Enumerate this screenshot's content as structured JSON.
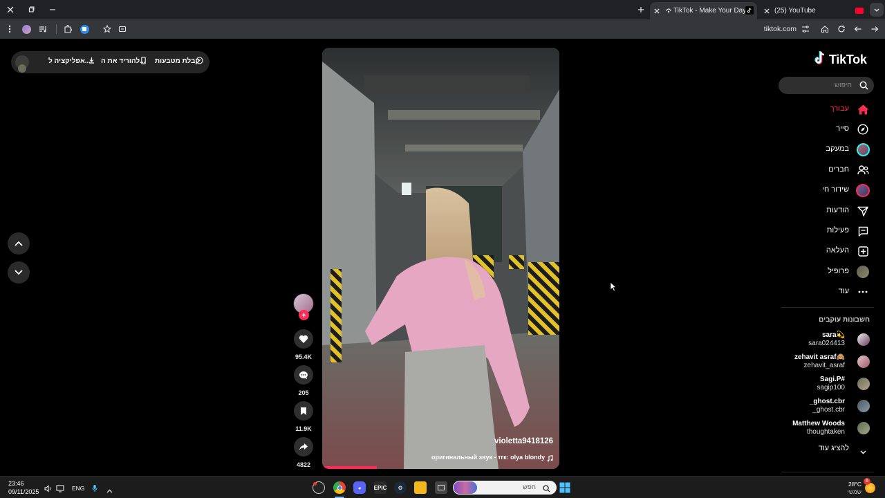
{
  "browser": {
    "tabs": [
      {
        "title": "TikTok - Make Your Day",
        "active": true
      },
      {
        "title": "(25) YouTube",
        "active": false
      }
    ],
    "address": "tiktok.com"
  },
  "banner": {
    "coins": "קבלת מטבעות",
    "download": "להוריד את ה...",
    "app": "אפליקציה ל..."
  },
  "tiktok": {
    "logo_text": "TikTok",
    "search_placeholder": "חיפוש",
    "nav": [
      {
        "label": "עבורך",
        "icon": "home-icon",
        "active": true
      },
      {
        "label": "סייר",
        "icon": "compass-icon"
      },
      {
        "label": "במעקב",
        "icon": "following-avatar-icon"
      },
      {
        "label": "חברים",
        "icon": "friends-icon"
      },
      {
        "label": "שידור חי",
        "icon": "live-icon"
      },
      {
        "label": "הודעות",
        "icon": "send-icon"
      },
      {
        "label": "פעילות",
        "icon": "activity-icon"
      },
      {
        "label": "העלאה",
        "icon": "upload-icon"
      },
      {
        "label": "פרופיל",
        "icon": "profile-avatar-icon"
      },
      {
        "label": "עוד",
        "icon": "more-icon"
      }
    ],
    "following_title": "חשבונות עוקבים",
    "following": [
      {
        "name": "sara💫",
        "handle": "sara024413"
      },
      {
        "name": "zehavit asraf🙈",
        "handle": "zehavit_asraf"
      },
      {
        "name": "Sagi.P#",
        "handle": "sagip100"
      },
      {
        "name": "_ghost.cbr",
        "handle": "_ghost.cbr"
      },
      {
        "name": "Matthew Woods",
        "handle": "thoughtaken"
      }
    ],
    "show_more": "להציג עוד",
    "accent": "#fe2c55"
  },
  "video": {
    "author": "violetta9418126",
    "sound": "оригинальный звук - тгк: olya blondy",
    "progress": 0.23,
    "likes": "95.4K",
    "comments": "205",
    "saves": "11.9K",
    "shares": "4822"
  },
  "taskbar": {
    "time": "23:46",
    "date": "09/11/2025",
    "lang": "ENG",
    "search_placeholder": "חפש",
    "weather_temp": "28°C",
    "weather_desc": "שמשי",
    "notif_count": "6"
  }
}
